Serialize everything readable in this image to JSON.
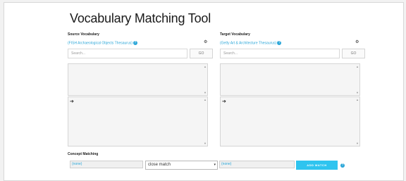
{
  "title": "Vocabulary Matching Tool",
  "source": {
    "heading": "Source Vocabulary",
    "vocab_link": "(FISH Archaeological Objects Thesaurus)",
    "search_placeholder": "Search...",
    "go_label": "GO"
  },
  "target": {
    "heading": "Target Vocabulary",
    "vocab_link": "(Getty Art & Architecture Thesaurus)",
    "search_placeholder": "Search...",
    "go_label": "GO"
  },
  "concept": {
    "heading": "Concept Matching",
    "source_value": "(none)",
    "match_type": "close match",
    "target_value": "(none)",
    "add_label": "ADD MATCH"
  },
  "icons": {
    "help": "?",
    "gear": "⚙",
    "arrow": "➔",
    "caret": "▾",
    "scroll_up": "▲",
    "scroll_down": "▼"
  },
  "colors": {
    "accent": "#2fc4ef",
    "link": "#2aa6d8"
  }
}
